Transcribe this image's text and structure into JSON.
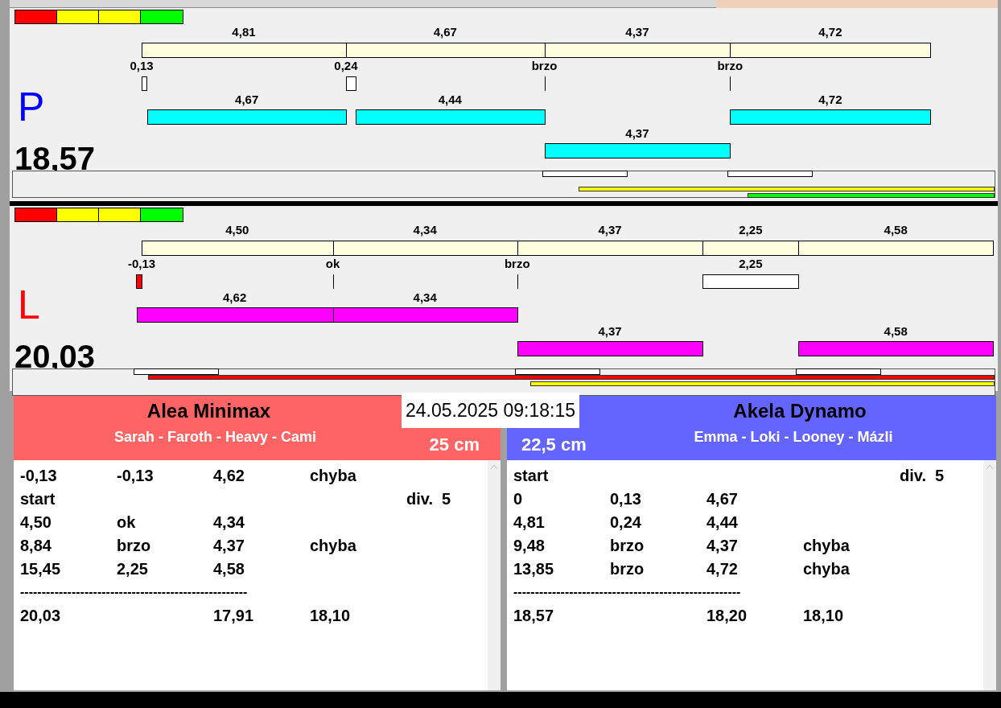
{
  "lanes": [
    {
      "letter": "P",
      "color": "#0000ff",
      "total": "18,57",
      "scale": [
        {
          "color": "#ff0000"
        },
        {
          "color": "#ffff00"
        },
        {
          "color": "#ffff00"
        },
        {
          "color": "#00ff00"
        }
      ],
      "segments": [
        {
          "time": "4,81",
          "mark": {
            "kind": "gap",
            "label": "0,13"
          },
          "upper_dog": {
            "time": "4,67",
            "color": "#00ffff"
          },
          "window": false
        },
        {
          "time": "4,67",
          "mark": {
            "kind": "gap",
            "label": "0,24"
          },
          "upper_dog": {
            "time": "4,44",
            "color": "#00ffff"
          },
          "window": false
        },
        {
          "time": "4,37",
          "mark": {
            "kind": "tick",
            "label": "brzo"
          },
          "lower_dog": {
            "time": "4,37",
            "color": "#00ffff"
          },
          "window": true
        },
        {
          "time": "4,72",
          "mark": {
            "kind": "tick",
            "label": "brzo"
          },
          "upper_dog": {
            "time": "4,72",
            "color": "#00ffff"
          },
          "window": true
        }
      ],
      "lines": [
        {
          "color": "#ffff00",
          "level": 0.424
        },
        {
          "color": "#00ff00",
          "level": 0.252
        }
      ]
    },
    {
      "letter": "L",
      "color": "#ff0000",
      "total": "20,03",
      "scale": [
        {
          "color": "#ff0000"
        },
        {
          "color": "#ffff00"
        },
        {
          "color": "#ffff00"
        },
        {
          "color": "#00ff00"
        }
      ],
      "segments": [
        {
          "time": "4,50",
          "mark": {
            "kind": "early",
            "label": "-0,13"
          },
          "upper_dog": {
            "time": "4,62",
            "color": "#ff00ff"
          },
          "window": true
        },
        {
          "time": "4,34",
          "mark": {
            "kind": "tick",
            "label": "ok"
          },
          "upper_dog": {
            "time": "4,34",
            "color": "#ff00ff"
          },
          "window": false
        },
        {
          "time": "4,37",
          "mark": {
            "kind": "tick",
            "label": "brzo"
          },
          "lower_dog": {
            "time": "4,37",
            "color": "#ff00ff"
          },
          "window": true
        },
        {
          "time": "2,25",
          "mark": {
            "kind": "box",
            "label": "2,25"
          },
          "window": false
        },
        {
          "time": "4,58",
          "lower_dog": {
            "time": "4,58",
            "color": "#ff00ff"
          },
          "window": true
        }
      ],
      "lines": [
        {
          "color": "#ff0000",
          "level": 0.862
        },
        {
          "color": "#ffff00",
          "level": 0.473
        }
      ]
    }
  ],
  "timestamp": "24.05.2025 09:18:15",
  "teams": [
    {
      "name": "Alea Minimax",
      "dogs": "Sarah - Faroth - Heavy - Cami",
      "height": "25 cm",
      "color": "#ff6464",
      "rows": [
        {
          "kind": "data",
          "cells": [
            "-0,13",
            "-0,13",
            "4,62",
            "chyba"
          ]
        },
        {
          "kind": "data",
          "cells": [
            "start",
            "",
            "",
            "",
            "div.  5"
          ]
        },
        {
          "kind": "data",
          "cells": [
            "4,50",
            "ok",
            "4,34"
          ]
        },
        {
          "kind": "data",
          "cells": [
            "8,84",
            "brzo",
            "4,37",
            "chyba"
          ]
        },
        {
          "kind": "data",
          "cells": [
            "15,45",
            "2,25",
            "4,58"
          ]
        },
        {
          "kind": "separator",
          "cells": [
            "-----------------------------------------------------"
          ]
        },
        {
          "kind": "data",
          "cells": [
            "20,03",
            "",
            "17,91",
            "18,10"
          ]
        }
      ]
    },
    {
      "name": "Akela Dynamo",
      "dogs": "Emma - Loki - Looney - Mázli",
      "height": "22,5 cm",
      "color": "#6464ff",
      "rows": [
        {
          "kind": "data",
          "cells": [
            "start",
            "",
            "",
            "",
            "div.  5"
          ]
        },
        {
          "kind": "data",
          "cells": [
            "0",
            "0,13",
            "4,67"
          ]
        },
        {
          "kind": "data",
          "cells": [
            "4,81",
            "0,24",
            "4,44"
          ]
        },
        {
          "kind": "data",
          "cells": [
            "9,48",
            "brzo",
            "4,37",
            "chyba"
          ]
        },
        {
          "kind": "data",
          "cells": [
            "13,85",
            "brzo",
            "4,72",
            "chyba"
          ]
        },
        {
          "kind": "separator",
          "cells": [
            "-----------------------------------------------------"
          ]
        },
        {
          "kind": "data",
          "cells": [
            "18,57",
            "",
            "18,20",
            "18,10"
          ]
        }
      ]
    }
  ]
}
